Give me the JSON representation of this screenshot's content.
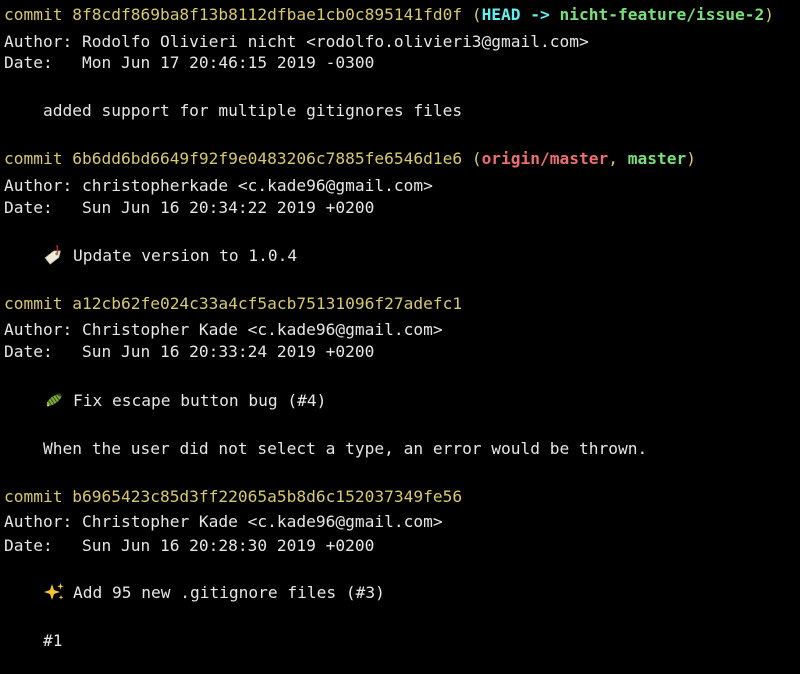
{
  "commits": [
    {
      "word": "commit",
      "hash": "8f8cdf869ba8f13b8112dfbae1cb0c895141fd0f",
      "refs_open": "(",
      "head": "HEAD",
      "arrow": " -> ",
      "branch": "nicht-feature/issue-2",
      "refs_close": ")",
      "author_label": "Author:",
      "author": "Rodolfo Olivieri nicht <rodolfo.olivieri3@gmail.com>",
      "date_label": "Date:",
      "date": "Mon Jun 17 20:46:15 2019 -0300",
      "message": "added support for multiple gitignores files"
    },
    {
      "word": "commit",
      "hash": "6b6dd6bd6649f92f9e0483206c7885fe6546d1e6",
      "refs_open": "(",
      "remote_branch": "origin/master",
      "comma": ", ",
      "branch": "master",
      "refs_close": ")",
      "author_label": "Author:",
      "author": "christopherkade <c.kade96@gmail.com>",
      "date_label": "Date:",
      "date": "Sun Jun 16 20:34:22 2019 +0200",
      "emoji_icon": "label-tag-icon",
      "message": "Update version to 1.0.4"
    },
    {
      "word": "commit",
      "hash": "a12cb62fe024c33a4cf5acb75131096f27adefc1",
      "author_label": "Author:",
      "author": "Christopher Kade <c.kade96@gmail.com>",
      "date_label": "Date:",
      "date": "Sun Jun 16 20:33:24 2019 +0200",
      "emoji_icon": "bug-icon",
      "message": "Fix escape button bug (#4)",
      "body": "When the user did not select a type, an error would be thrown."
    },
    {
      "word": "commit",
      "hash": "b6965423c85d3ff22065a5b8d6c152037349fe56",
      "author_label": "Author:",
      "author": "Christopher Kade <c.kade96@gmail.com>",
      "date_label": "Date:",
      "date": "Sun Jun 16 20:28:30 2019 +0200",
      "emoji_icon": "sparkles-icon",
      "message": "Add 95 new .gitignore files (#3)",
      "body": "#1"
    }
  ],
  "colors": {
    "background": "#000000",
    "text": "#e6e6e6",
    "commit_hash": "#d8c96a",
    "head": "#5ff0f0",
    "local_branch": "#78e07a",
    "remote_branch": "#ee6d6d"
  }
}
